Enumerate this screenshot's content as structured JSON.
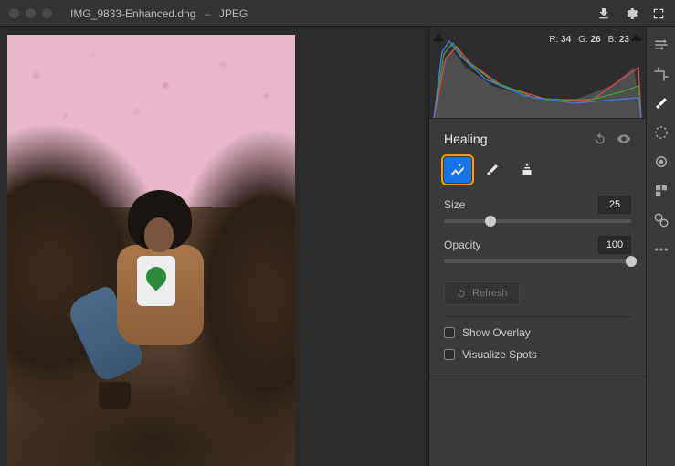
{
  "titlebar": {
    "filename": "IMG_9833-Enhanced.dng",
    "format": "JPEG"
  },
  "histogram": {
    "r_label": "R:",
    "r_value": "34",
    "g_label": "G:",
    "g_value": "26",
    "b_label": "B:",
    "b_value": "23"
  },
  "panel": {
    "title": "Healing",
    "tools": [
      "content-aware-remove",
      "heal",
      "clone"
    ],
    "size_label": "Size",
    "size_value": "25",
    "opacity_label": "Opacity",
    "opacity_value": "100",
    "refresh_label": "Refresh",
    "show_overlay_label": "Show Overlay",
    "visualize_spots_label": "Visualize Spots"
  },
  "right_tools": [
    "edit-sliders",
    "crop",
    "healing",
    "masking",
    "redeye",
    "presets",
    "snapshots",
    "more"
  ]
}
